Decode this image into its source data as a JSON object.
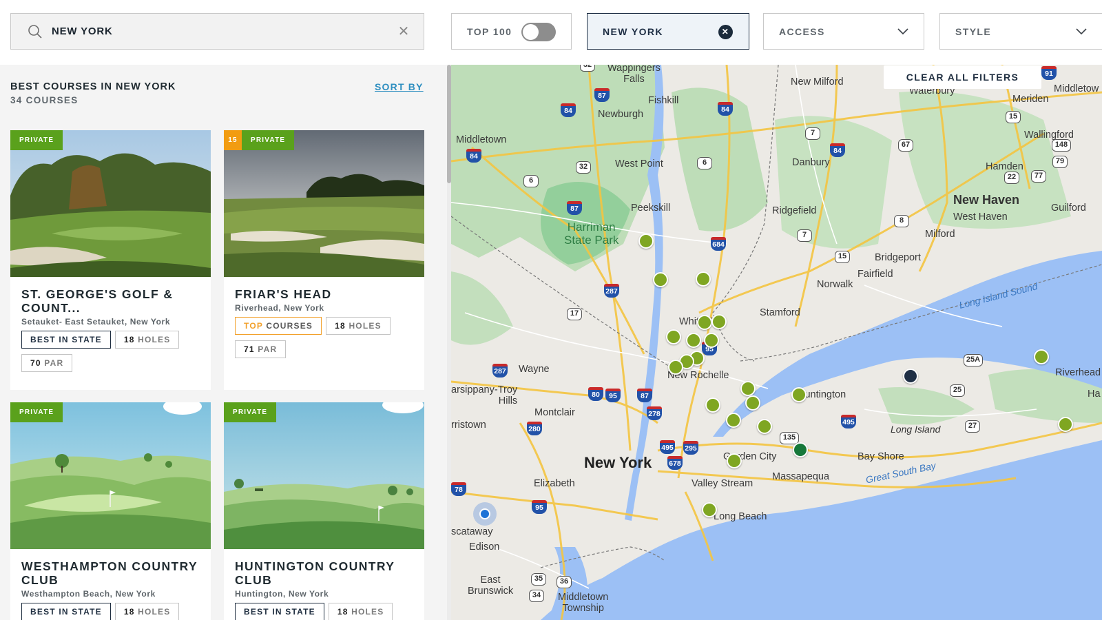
{
  "search": {
    "value": "NEW YORK",
    "clear_icon": "close-icon"
  },
  "filters": {
    "top100": {
      "label": "TOP 100",
      "enabled": false
    },
    "location": {
      "label": "NEW YORK"
    },
    "access": {
      "label": "ACCESS"
    },
    "style": {
      "label": "STYLE"
    }
  },
  "list": {
    "title": "BEST COURSES IN NEW YORK",
    "count": "34 COURSES",
    "sort_label": "SORT BY"
  },
  "courses": [
    {
      "badge": "PRIVATE",
      "rank": "",
      "name": "ST. GEORGE'S GOLF & COUNT...",
      "location": "Setauket- East Setauket, New York",
      "tags": {
        "best": "BEST IN STATE",
        "holes_num": "18",
        "holes_unit": "HOLES",
        "par_num": "70",
        "par_unit": "PAR"
      }
    },
    {
      "badge": "PRIVATE",
      "rank": "15",
      "name": "FRIAR'S HEAD",
      "location": "Riverhead, New York",
      "tags": {
        "top_prefix": "TOP",
        "top_rest": "COURSES",
        "holes_num": "18",
        "holes_unit": "HOLES",
        "par_num": "71",
        "par_unit": "PAR"
      }
    },
    {
      "badge": "PRIVATE",
      "rank": "",
      "name": "WESTHAMPTON COUNTRY CLUB",
      "location": "Westhampton Beach, New York",
      "tags": {
        "best": "BEST IN STATE",
        "holes_num": "18",
        "holes_unit": "HOLES"
      }
    },
    {
      "badge": "PRIVATE",
      "rank": "",
      "name": "HUNTINGTON COUNTRY CLUB",
      "location": "Huntington, New York",
      "tags": {
        "best": "BEST IN STATE",
        "holes_num": "18",
        "holes_unit": "HOLES"
      }
    }
  ],
  "map": {
    "clear_filters": "CLEAR ALL FILTERS",
    "labels": {
      "wappingers_falls": "Wappingers\nFalls",
      "new_milford": "New Milford",
      "waterbury": "Waterbury",
      "middletown_ct": "Middletow",
      "meriden": "Meriden",
      "fishkill": "Fishkill",
      "newburgh": "Newburgh",
      "wallingford": "Wallingford",
      "middletown_ny": "Middletown",
      "west_point": "West Point",
      "danbury": "Danbury",
      "hamden": "Hamden",
      "new_haven": "New Haven",
      "guilford": "Guilford",
      "west_haven": "West Haven",
      "peekskill": "Peekskill",
      "ridgefield": "Ridgefield",
      "harriman": "Harriman\nState Park",
      "milford": "Milford",
      "bridgeport": "Bridgeport",
      "fairfield": "Fairfield",
      "norwalk": "Norwalk",
      "long_island_sound": "Long Island Sound",
      "white_plains": "White P",
      "stamford": "Stamford",
      "riverhead": "Riverhead",
      "wayne": "Wayne",
      "new_rochelle": "New Rochelle",
      "parsippany": "arsippany-Troy\nHills",
      "huntington": "Huntington",
      "montclair": "Montclair",
      "morristown": "rristown",
      "long_island": "Long Island",
      "ha": "Ha",
      "garden_city": "Garden City",
      "bay_shore": "Bay Shore",
      "new_york": "New York",
      "massapequa": "Massapequa",
      "great_south_bay": "Great South Bay",
      "elizabeth": "Elizabeth",
      "valley_stream": "Valley Stream",
      "long_beach": "Long Beach",
      "piscataway": "scataway",
      "edison": "Edison",
      "east_brunswick": "East\nBrunswick",
      "middletown_nj": "Middletown\nTownship"
    },
    "highways": {
      "i84a": "84",
      "i84b": "84",
      "i84c": "84",
      "i84d": "84",
      "i87a": "87",
      "i87b": "87",
      "i287a": "287",
      "i287b": "287",
      "i684": "684",
      "i95a": "95",
      "i95b": "95",
      "i95c": "95",
      "i80": "80",
      "i87c": "87",
      "i278": "278",
      "i280": "280",
      "i495a": "495",
      "i295": "295",
      "i678": "678",
      "i495b": "495",
      "i91": "91",
      "i78": "78",
      "r32a": "32",
      "r32b": "32",
      "r6a": "6",
      "r6b": "6",
      "r7a": "7",
      "r7b": "7",
      "r8": "8",
      "r15a": "15",
      "r15b": "15",
      "r67": "67",
      "r22": "22",
      "r77": "77",
      "r79": "79",
      "r148": "148",
      "r17": "17",
      "r25a": "25A",
      "r25b": "25",
      "r27": "27",
      "r135": "135",
      "r35": "35",
      "r36": "36",
      "r34": "34"
    }
  },
  "colors": {
    "accent_green": "#5aa11c",
    "rank_orange": "#f29c11",
    "navy": "#1f2e40",
    "link_blue": "#2f8fc0",
    "pin_olive": "#7fa622"
  }
}
